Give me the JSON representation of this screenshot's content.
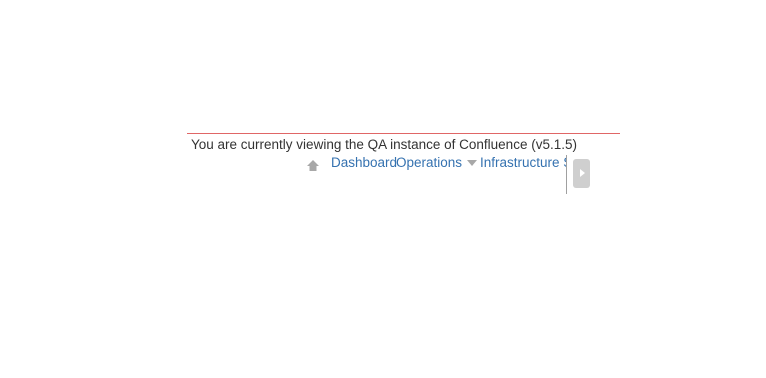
{
  "banner": {
    "text": "You are currently viewing the QA instance of Confluence (v5.1.5)",
    "rule_color": "#e06666"
  },
  "breadcrumbs": {
    "home_icon": "home-icon",
    "items": [
      {
        "label": "Dashboard"
      },
      {
        "label": "Operations"
      },
      {
        "label": "Infrastructure S"
      }
    ],
    "link_color": "#3572b0",
    "dropdown_icon": "caret-down-icon"
  },
  "sidebar_toggle": {
    "icon": "chevron-right-icon"
  }
}
